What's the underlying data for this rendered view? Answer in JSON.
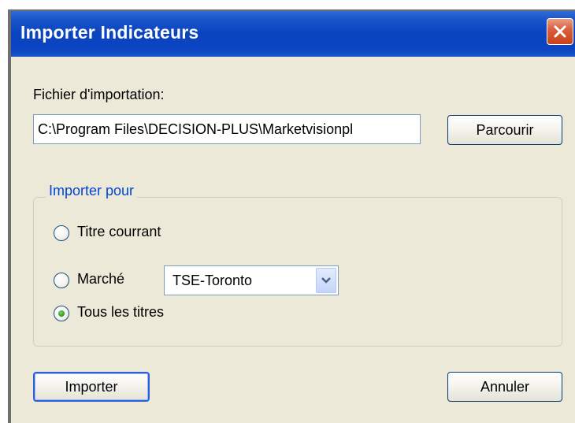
{
  "window": {
    "title": "Importer Indicateurs"
  },
  "import_file": {
    "label": "Fichier d'importation:",
    "value": "C:\\Program Files\\DECISION-PLUS\\Marketvisionpl",
    "browse_label": "Parcourir"
  },
  "import_for": {
    "legend": "Importer pour",
    "options": [
      {
        "label": "Titre courrant",
        "selected": false
      },
      {
        "label": "Marché",
        "selected": false
      },
      {
        "label": "Tous les titres",
        "selected": true
      }
    ],
    "market_select": {
      "value": "TSE-Toronto"
    }
  },
  "actions": {
    "import_label": "Importer",
    "cancel_label": "Annuler"
  },
  "icons": {
    "close": "close-icon",
    "dropdown": "chevron-down-icon"
  },
  "colors": {
    "titlebar": "#0a43be",
    "dialog_background": "#ece9d8",
    "group_legend": "#0046d5",
    "close_button": "#d9603d"
  }
}
